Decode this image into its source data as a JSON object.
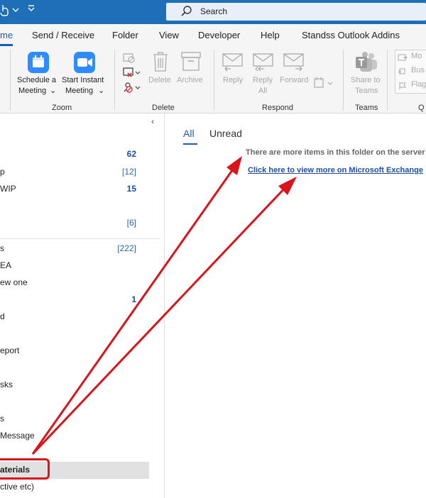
{
  "titlebar": {
    "search_placeholder": "Search"
  },
  "menu": {
    "tabs": [
      {
        "label": "me",
        "active": true
      },
      {
        "label": "Send / Receive"
      },
      {
        "label": "Folder"
      },
      {
        "label": "View"
      },
      {
        "label": "Developer"
      },
      {
        "label": "Help"
      },
      {
        "label": "Standss Outlook Addins"
      }
    ]
  },
  "ribbon": {
    "zoom": {
      "label": "Zoom",
      "schedule_l1": "Schedule a",
      "schedule_l2": "Meeting",
      "instant_l1": "Start Instant",
      "instant_l2": "Meeting"
    },
    "delete": {
      "label": "Delete",
      "delete_btn": "Delete",
      "archive_btn": "Archive"
    },
    "respond": {
      "label": "Respond",
      "reply": "Reply",
      "reply_all_l1": "Reply",
      "reply_all_l2": "All",
      "forward": "Forward"
    },
    "teams": {
      "label": "Teams",
      "share_l1": "Share to",
      "share_l2": "Teams"
    },
    "quick": {
      "label": "Q",
      "item1": "Mo",
      "item2": "Bus",
      "item3": "Flag"
    }
  },
  "folders": [
    {
      "name": "",
      "count": "62",
      "bold": true
    },
    {
      "name": "p",
      "count": "[12]"
    },
    {
      "name": "WIP",
      "count": "15",
      "bold": true
    },
    {
      "name": "",
      "count": "[6]"
    },
    {
      "name": "s",
      "count": "[222]"
    },
    {
      "name": "EA",
      "count": ""
    },
    {
      "name": "ew one",
      "count": ""
    },
    {
      "name": "",
      "count": "1",
      "bold": true
    },
    {
      "name": "d",
      "count": ""
    },
    {
      "name": "eport",
      "count": ""
    },
    {
      "name": "sks",
      "count": ""
    },
    {
      "name": "s",
      "count": ""
    },
    {
      "name": "Message",
      "count": ""
    },
    {
      "name": "aterials",
      "count": "",
      "selected": true
    },
    {
      "name": "ctive etc)",
      "count": ""
    }
  ],
  "message_list": {
    "tab_all": "All",
    "tab_unread": "Unread",
    "server_notice": "There are more items in this folder on the server",
    "exchange_link": "Click here to view more on Microsoft Exchange"
  },
  "colors": {
    "title_bar": "#1f6fb8",
    "accent": "#185abd",
    "annotation_red": "#d9141b"
  }
}
